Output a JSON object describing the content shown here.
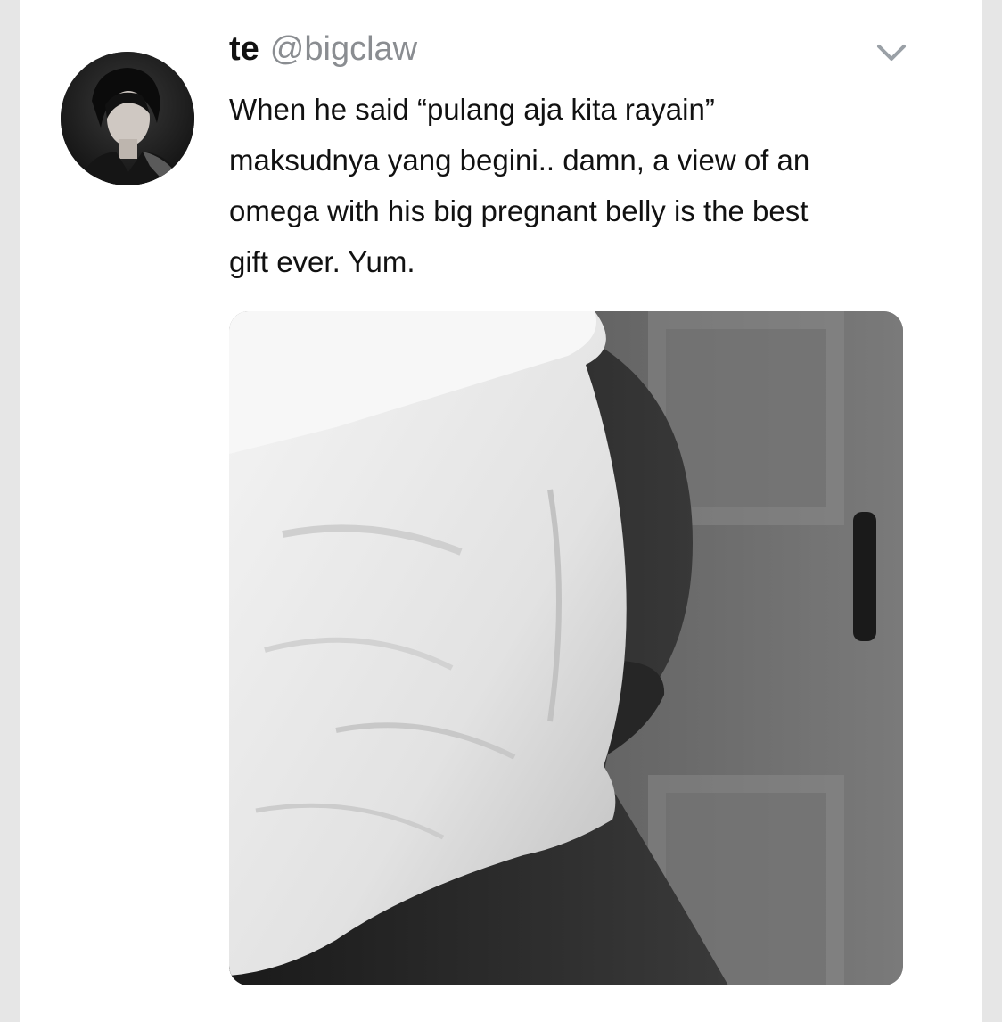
{
  "tweet": {
    "display_name": "te",
    "handle": "@bigclaw",
    "text_lines": [
      "When he said “pulang aja kita rayain”",
      "maksudnya yang begini.. damn, a view of an",
      "omega with his big pregnant belly is the best",
      "gift ever. Yum."
    ]
  },
  "icons": {
    "menu": "chevron-down-icon"
  },
  "colors": {
    "text": "#111111",
    "handle": "#8a8d91",
    "background": "#e6e6e6",
    "card": "#ffffff"
  }
}
